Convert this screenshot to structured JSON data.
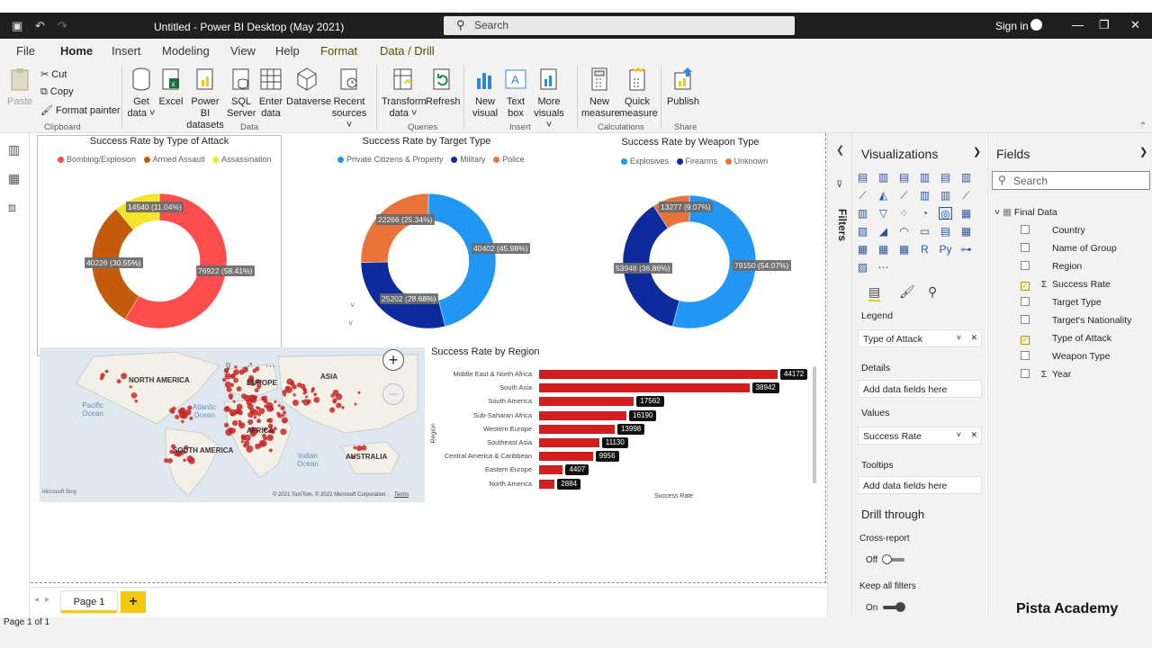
{
  "window": {
    "title": "Untitled - Power BI Desktop (May 2021)",
    "search_placeholder": "Search",
    "signin": "Sign in"
  },
  "menu": [
    {
      "label": "File"
    },
    {
      "label": "Home"
    },
    {
      "label": "Insert"
    },
    {
      "label": "Modeling"
    },
    {
      "label": "View"
    },
    {
      "label": "Help"
    },
    {
      "label": "Format"
    },
    {
      "label": "Data / Drill"
    }
  ],
  "ribbon": {
    "paste": "Paste",
    "cut": "Cut",
    "copy": "Copy",
    "format_painter": "Format painter",
    "groups": {
      "clipboard": "Clipboard",
      "data": "Data",
      "queries": "Queries",
      "insert": "Insert",
      "calculations": "Calculations",
      "share": "Share"
    },
    "get_data": "Get data",
    "excel": "Excel",
    "pbi_datasets": "Power BI datasets",
    "sql_server": "SQL Server",
    "enter_data": "Enter data",
    "dataverse": "Dataverse",
    "recent_sources": "Recent sources",
    "transform_data": "Transform data",
    "refresh": "Refresh",
    "new_visual": "New visual",
    "text_box": "Text box",
    "more_visuals": "More visuals",
    "new_measure": "New measure",
    "quick_measure": "Quick measure",
    "publish": "Publish"
  },
  "charts": {
    "attack": {
      "title": "Success Rate by Type of Attack",
      "legend": [
        "Bombing/Explosion",
        "Armed Assault",
        "Assassination"
      ],
      "labels": [
        "14540 (11.04%)",
        "40226 (30.55%)",
        "76922 (58.41%)"
      ]
    },
    "target": {
      "title": "Success Rate by Target Type",
      "legend": [
        "Private Citizens & Property",
        "Military",
        "Police"
      ],
      "labels": [
        "22266 (25.34%)",
        "40402 (45.98%)",
        "25202 (28.68%)"
      ]
    },
    "weapon": {
      "title": "Success Rate by Weapon Type",
      "legend": [
        "Explosives",
        "Firearms",
        "Unknown"
      ],
      "labels": [
        "13277 (9.07%)",
        "53948 (36.86%)",
        "79150 (54.07%)"
      ]
    },
    "region": {
      "title": "Success Rate by Region",
      "xlabel": "Success Rate",
      "ylabel": "Region"
    },
    "map": {
      "labels": [
        "NORTH AMERICA",
        "EUROPE",
        "ASIA",
        "AFRICA",
        "SOUTH AMERICA",
        "AUSTRALIA",
        "Pacific Ocean",
        "Atlantic Ocean",
        "Indian Ocean"
      ],
      "copyright": "© 2021 TomTom, © 2022 Microsoft Corporation",
      "terms": "Terms",
      "brand": "Microsoft Bing"
    }
  },
  "chart_data": [
    {
      "type": "pie",
      "title": "Success Rate by Type of Attack",
      "categories": [
        "Bombing/Explosion",
        "Armed Assault",
        "Assassination"
      ],
      "values": [
        76922,
        40226,
        14540
      ],
      "colors": [
        "#fd4d4d",
        "#c45a0b",
        "#f5e52a"
      ]
    },
    {
      "type": "pie",
      "title": "Success Rate by Target Type",
      "categories": [
        "Private Citizens & Property",
        "Military",
        "Police"
      ],
      "values": [
        40402,
        25202,
        22266
      ],
      "colors": [
        "#2196f3",
        "#0d2b9c",
        "#e8743b"
      ]
    },
    {
      "type": "pie",
      "title": "Success Rate by Weapon Type",
      "categories": [
        "Explosives",
        "Firearms",
        "Unknown"
      ],
      "values": [
        79150,
        53948,
        13277
      ],
      "colors": [
        "#2196f3",
        "#0d2b9c",
        "#e8743b"
      ]
    },
    {
      "type": "bar",
      "title": "Success Rate by Region",
      "xlabel": "Success Rate",
      "ylabel": "Region",
      "categories": [
        "Middle East & North Africa",
        "South Asia",
        "South America",
        "Sub-Saharan Africa",
        "Western Europe",
        "Southeast Asia",
        "Central America & Caribbean",
        "Eastern Europe",
        "North America"
      ],
      "values": [
        44172,
        38942,
        17562,
        16190,
        13998,
        11130,
        9956,
        4407,
        2884
      ],
      "color": "#d11f1f"
    }
  ],
  "page": {
    "tab": "Page 1",
    "status": "Page 1 of 1"
  },
  "filters": {
    "label": "Filters"
  },
  "viz": {
    "title": "Visualizations",
    "legend": "Legend",
    "legend_field": "Type of Attack",
    "details": "Details",
    "details_empty": "Add data fields here",
    "values": "Values",
    "values_field": "Success Rate",
    "tooltips": "Tooltips",
    "tooltips_empty": "Add data fields here",
    "drill": "Drill through",
    "cross_report": "Cross-report",
    "off": "Off",
    "keep_filters": "Keep all filters",
    "on": "On"
  },
  "fields": {
    "title": "Fields",
    "search_placeholder": "Search",
    "table": "Final Data",
    "items": [
      {
        "label": "Country",
        "checked": false,
        "sigma": false
      },
      {
        "label": "Name of Group",
        "checked": false,
        "sigma": false
      },
      {
        "label": "Region",
        "checked": false,
        "sigma": false
      },
      {
        "label": "Success Rate",
        "checked": true,
        "sigma": true
      },
      {
        "label": "Target Type",
        "checked": false,
        "sigma": false
      },
      {
        "label": "Target's Nationality",
        "checked": false,
        "sigma": false
      },
      {
        "label": "Type of Attack",
        "checked": true,
        "sigma": false
      },
      {
        "label": "Weapon Type",
        "checked": false,
        "sigma": false
      },
      {
        "label": "Year",
        "checked": false,
        "sigma": true
      }
    ]
  },
  "watermark": "Pista Academy"
}
